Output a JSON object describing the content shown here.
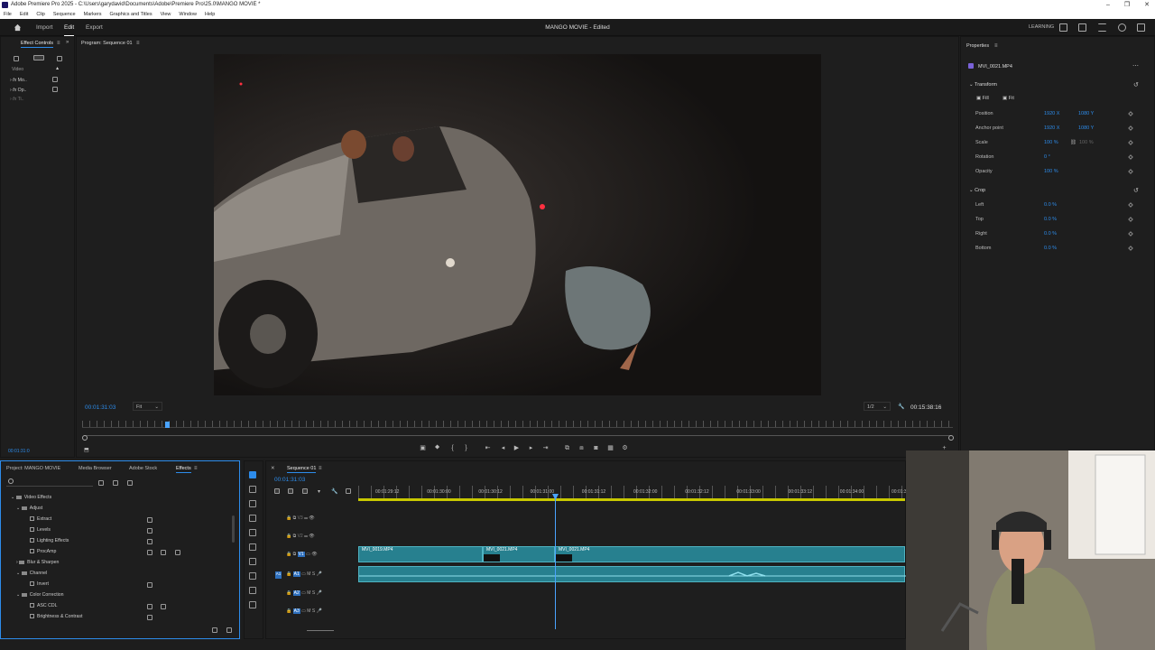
{
  "window": {
    "title": "Adobe Premiere Pro 2025 - C:\\Users\\garydavid\\Documents\\Adobe\\Premiere Pro\\25.0\\MANGO MOVIE *",
    "controls": [
      "–",
      "❐",
      "✕"
    ]
  },
  "menu": [
    "File",
    "Edit",
    "Clip",
    "Sequence",
    "Markers",
    "Graphics and Titles",
    "View",
    "Window",
    "Help"
  ],
  "header": {
    "home_icon": "home-icon",
    "nav": [
      "Import",
      "Edit",
      "Export"
    ],
    "sequence_title": "MANGO MOVIE - Edited",
    "learning": "LEARNING"
  },
  "effect_controls": {
    "tab": "Effect Controls",
    "section": "Video",
    "items": [
      "Mo..",
      "Op..",
      "Ti.."
    ],
    "timecode": "00:01:31:0"
  },
  "program": {
    "tab": "Program: Sequence 01",
    "timecode": "00:01:31:03",
    "fit": "Fit",
    "resolution": "1/2",
    "duration": "00:15:38:16"
  },
  "properties": {
    "tab": "Properties",
    "clip_name": "MVI_0021.MP4",
    "transform_title": "Transform",
    "fill_label": "Fill",
    "fit_label": "Fit",
    "rows": [
      {
        "label": "Position",
        "v1": "1920 X",
        "v2": "1080 Y"
      },
      {
        "label": "Anchor point",
        "v1": "1920 X",
        "v2": "1080 Y"
      },
      {
        "label": "Scale",
        "v1": "100 %",
        "v2": "100 %"
      },
      {
        "label": "Rotation",
        "v1": "0 °",
        "v2": ""
      },
      {
        "label": "Opacity",
        "v1": "100 %",
        "v2": ""
      }
    ],
    "crop_title": "Crop",
    "crop_rows": [
      {
        "label": "Left",
        "v1": "0.0 %"
      },
      {
        "label": "Top",
        "v1": "0.0 %"
      },
      {
        "label": "Right",
        "v1": "0.0 %"
      },
      {
        "label": "Bottom",
        "v1": "0.0 %"
      }
    ]
  },
  "project": {
    "tabs": [
      "Project: MANGO MOVIE",
      "Media Browser",
      "Adobe Stock",
      "Effects"
    ],
    "active_tab": "Effects",
    "tree": [
      {
        "label": "Video Effects",
        "level": 0,
        "type": "folder"
      },
      {
        "label": "Adjust",
        "level": 1,
        "type": "folder"
      },
      {
        "label": "Extract",
        "level": 2,
        "type": "fx"
      },
      {
        "label": "Levels",
        "level": 2,
        "type": "fx"
      },
      {
        "label": "Lighting Effects",
        "level": 2,
        "type": "fx"
      },
      {
        "label": "ProcAmp",
        "level": 2,
        "type": "fx"
      },
      {
        "label": "Blur & Sharpen",
        "level": 1,
        "type": "folder"
      },
      {
        "label": "Channel",
        "level": 1,
        "type": "folder"
      },
      {
        "label": "Invert",
        "level": 2,
        "type": "fx"
      },
      {
        "label": "Color Correction",
        "level": 1,
        "type": "folder"
      },
      {
        "label": "ASC CDL",
        "level": 2,
        "type": "fx"
      },
      {
        "label": "Brightness & Contrast",
        "level": 2,
        "type": "fx"
      }
    ]
  },
  "timeline": {
    "tab": "Sequence 01",
    "timecode": "00:01:31:03",
    "ruler": [
      "00:01:29:12",
      "00:01:30:00",
      "00:01:30:12",
      "00:01:31:00",
      "00:01:31:12",
      "00:01:32:00",
      "00:01:32:12",
      "00:01:33:00",
      "00:01:33:12",
      "00:01:34:00",
      "00:01:3"
    ],
    "tracks": [
      "V3",
      "V2",
      "V1",
      "A1",
      "A2",
      "A3"
    ],
    "clips": [
      "MVI_0019.MP4",
      "MVI_0021.MP4",
      "MVI_0021.MP4"
    ],
    "track_letters": {
      "mute": "M",
      "solo": "S"
    }
  },
  "colors": {
    "accent": "#2d8ceb",
    "clip": "#27808f",
    "playhead": "#4aa3ff"
  }
}
